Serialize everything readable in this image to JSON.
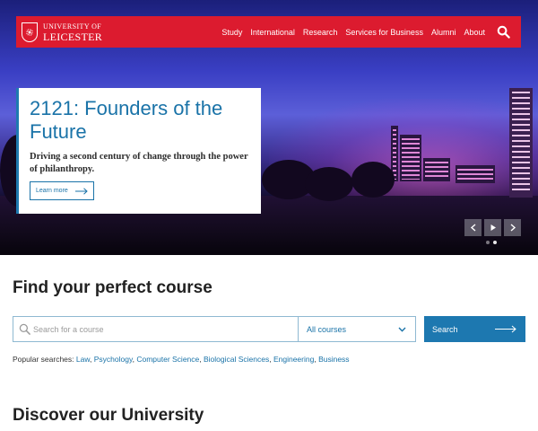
{
  "header": {
    "logo_line1": "UNIVERSITY OF",
    "logo_line2": "LEICESTER",
    "nav": [
      "Study",
      "International",
      "Research",
      "Services for Business",
      "Alumni",
      "About"
    ]
  },
  "hero": {
    "title": "2121: Founders of the Future",
    "subtitle": "Driving a second century of change through the power of philanthropy.",
    "cta_label": "Learn more"
  },
  "finder": {
    "title": "Find your perfect course",
    "search_placeholder": "Search for a course",
    "select_value": "All courses",
    "submit_label": "Search",
    "popular_label": "Popular searches:",
    "popular_links": [
      "Law",
      "Psychology",
      "Computer Science",
      "Biological Sciences",
      "Engineering",
      "Business"
    ]
  },
  "discover": {
    "title": "Discover our University"
  },
  "icons": {
    "search": "search-icon",
    "arrow": "arrow-right-icon",
    "chevron": "chevron-down-icon",
    "prev": "chevron-left-icon",
    "play": "play-icon",
    "next": "chevron-right-icon",
    "crest": "university-crest-icon"
  },
  "colors": {
    "brand_red": "#dc1b2f",
    "accent_blue": "#1a73a8",
    "button_blue": "#1d78b0"
  }
}
